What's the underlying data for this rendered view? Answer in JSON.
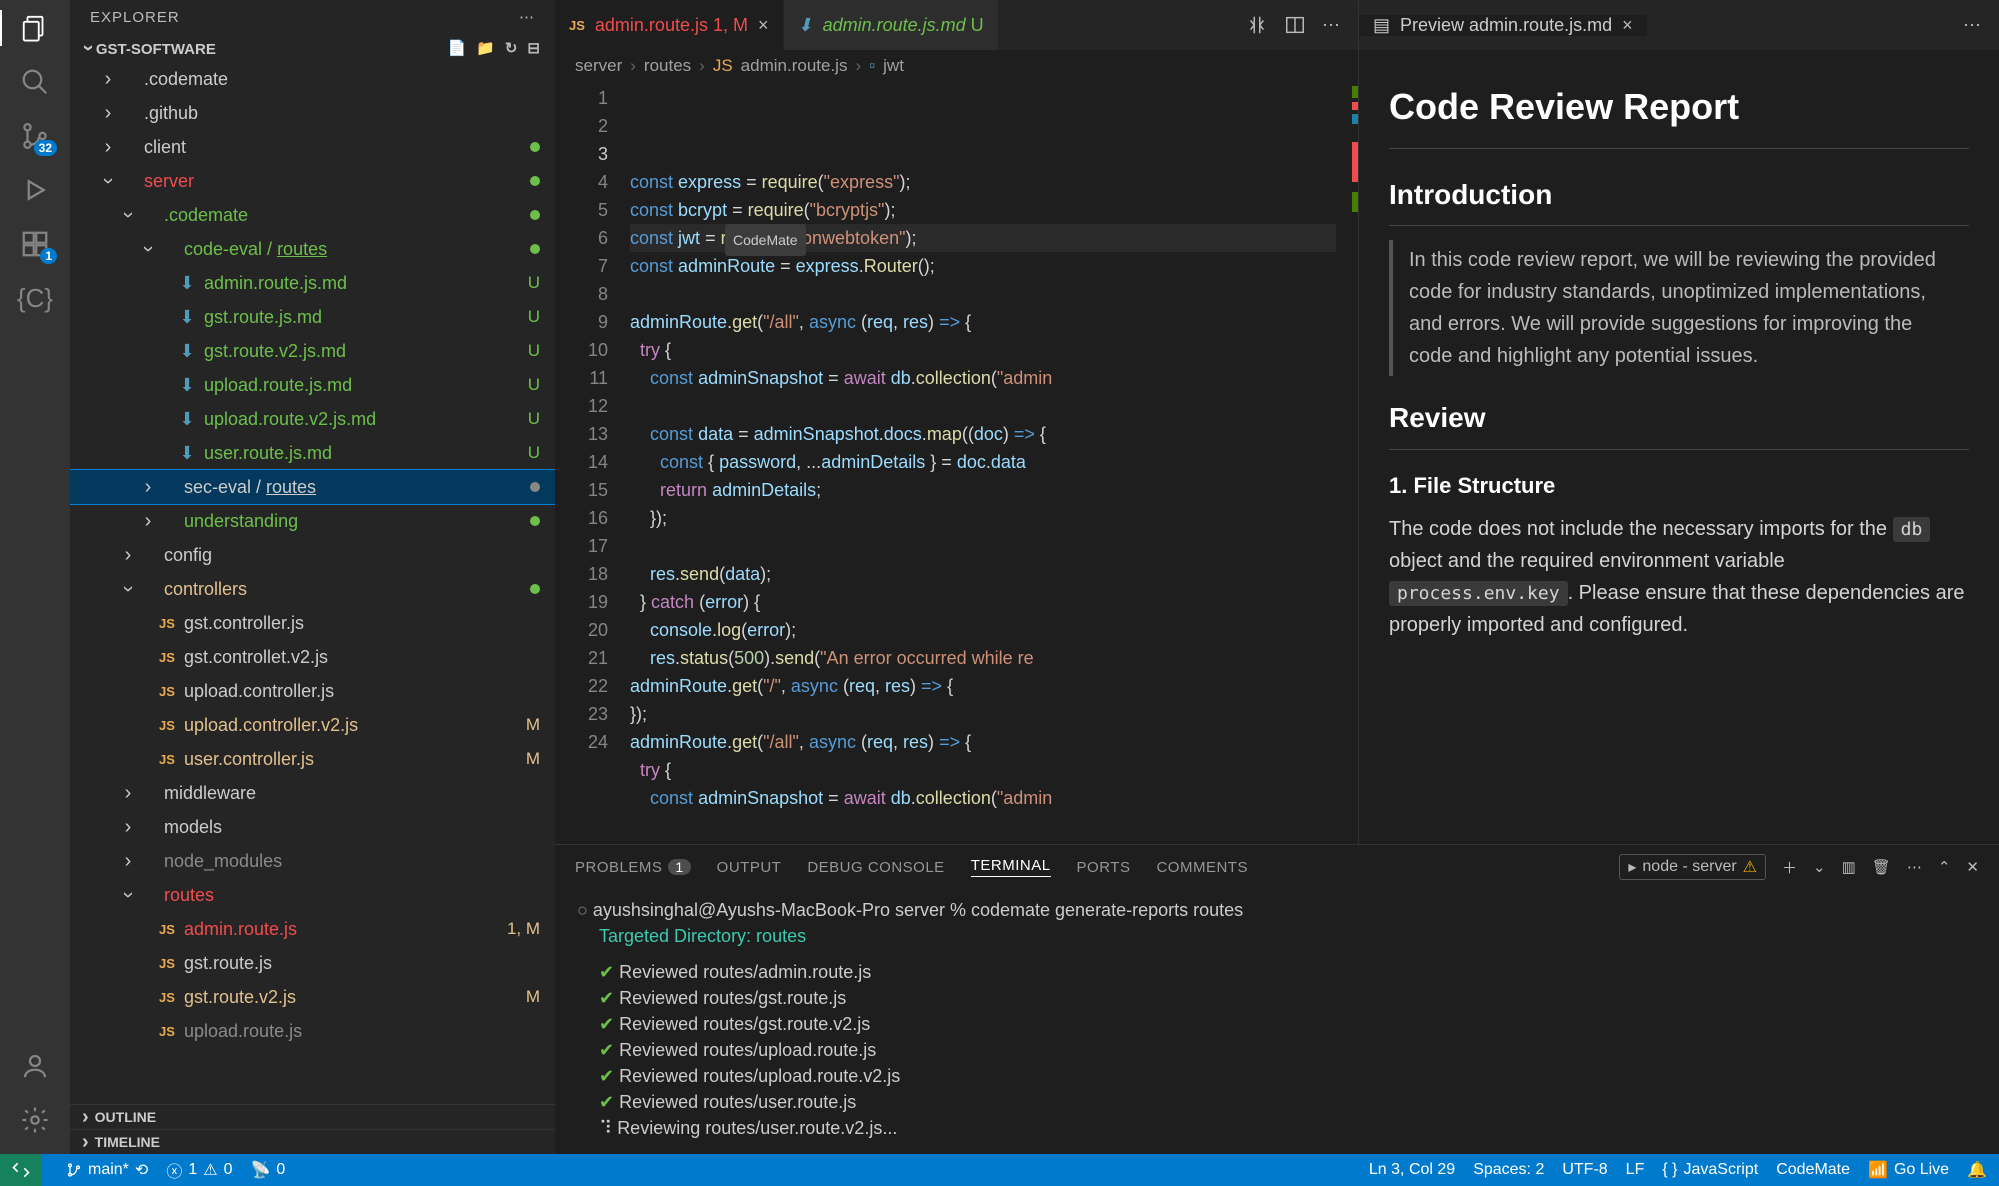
{
  "sidebar": {
    "title": "EXPLORER",
    "folder": "GST-SOFTWARE",
    "outline": "OUTLINE",
    "timeline": "TIMELINE"
  },
  "activity": {
    "scm_badge": "32",
    "ext_badge": "1"
  },
  "tree": [
    {
      "indent": 1,
      "chev": ">",
      "icon": "folder",
      "label": ".codemate",
      "color": ""
    },
    {
      "indent": 1,
      "chev": ">",
      "icon": "folder",
      "label": ".github",
      "color": ""
    },
    {
      "indent": 1,
      "chev": ">",
      "icon": "folder",
      "label": "client",
      "color": "",
      "status": "dot-green"
    },
    {
      "indent": 1,
      "chev": "v",
      "icon": "folder",
      "label": "server",
      "color": "fn-red",
      "status": "dot-green"
    },
    {
      "indent": 2,
      "chev": "v",
      "icon": "folder",
      "label": ".codemate",
      "color": "fn-green",
      "status": "dot-green"
    },
    {
      "indent": 3,
      "chev": "v",
      "icon": "folder",
      "label": "code-eval / routes",
      "color": "fn-green",
      "special": "routes-underline",
      "status": "dot-green"
    },
    {
      "indent": 4,
      "chev": "",
      "icon": "md",
      "label": "admin.route.js.md",
      "color": "fn-green",
      "status": "U"
    },
    {
      "indent": 4,
      "chev": "",
      "icon": "md",
      "label": "gst.route.js.md",
      "color": "fn-green",
      "status": "U"
    },
    {
      "indent": 4,
      "chev": "",
      "icon": "md",
      "label": "gst.route.v2.js.md",
      "color": "fn-green",
      "status": "U"
    },
    {
      "indent": 4,
      "chev": "",
      "icon": "md",
      "label": "upload.route.js.md",
      "color": "fn-green",
      "status": "U"
    },
    {
      "indent": 4,
      "chev": "",
      "icon": "md",
      "label": "upload.route.v2.js.md",
      "color": "fn-green",
      "status": "U"
    },
    {
      "indent": 4,
      "chev": "",
      "icon": "md",
      "label": "user.route.js.md",
      "color": "fn-green",
      "status": "U"
    },
    {
      "indent": 3,
      "chev": ">",
      "icon": "folder",
      "label": "sec-eval / routes",
      "color": "",
      "special": "routes-underline",
      "status": "dot-grey",
      "selected": true
    },
    {
      "indent": 3,
      "chev": ">",
      "icon": "folder",
      "label": "understanding",
      "color": "fn-green",
      "status": "dot-green"
    },
    {
      "indent": 2,
      "chev": ">",
      "icon": "folder",
      "label": "config",
      "color": ""
    },
    {
      "indent": 2,
      "chev": "v",
      "icon": "folder",
      "label": "controllers",
      "color": "fn-yellow",
      "status": "dot-green"
    },
    {
      "indent": 3,
      "chev": "",
      "icon": "js",
      "label": "gst.controller.js",
      "color": ""
    },
    {
      "indent": 3,
      "chev": "",
      "icon": "js",
      "label": "gst.controllet.v2.js",
      "color": ""
    },
    {
      "indent": 3,
      "chev": "",
      "icon": "js",
      "label": "upload.controller.js",
      "color": ""
    },
    {
      "indent": 3,
      "chev": "",
      "icon": "js",
      "label": "upload.controller.v2.js",
      "color": "fn-yellow",
      "status": "M"
    },
    {
      "indent": 3,
      "chev": "",
      "icon": "js",
      "label": "user.controller.js",
      "color": "fn-yellow",
      "status": "M"
    },
    {
      "indent": 2,
      "chev": ">",
      "icon": "folder",
      "label": "middleware",
      "color": ""
    },
    {
      "indent": 2,
      "chev": ">",
      "icon": "folder",
      "label": "models",
      "color": ""
    },
    {
      "indent": 2,
      "chev": ">",
      "icon": "folder",
      "label": "node_modules",
      "color": "fn-grey"
    },
    {
      "indent": 2,
      "chev": "v",
      "icon": "folder",
      "label": "routes",
      "color": "fn-red"
    },
    {
      "indent": 3,
      "chev": "",
      "icon": "js",
      "label": "admin.route.js",
      "color": "fn-red",
      "status": "1, M"
    },
    {
      "indent": 3,
      "chev": "",
      "icon": "js",
      "label": "gst.route.js",
      "color": ""
    },
    {
      "indent": 3,
      "chev": "",
      "icon": "js",
      "label": "gst.route.v2.js",
      "color": "fn-yellow",
      "status": "M"
    },
    {
      "indent": 3,
      "chev": "",
      "icon": "js",
      "label": "upload.route.js",
      "color": "fn-grey"
    }
  ],
  "tabs": [
    {
      "icon": "js",
      "label": "admin.route.js",
      "suffix": "1, M",
      "color": "fn-red",
      "close": "×",
      "active": true
    },
    {
      "icon": "md",
      "label": "admin.route.js.md",
      "suffix": "U",
      "color": "fn-green",
      "close": "",
      "active": false
    }
  ],
  "preview_tab": {
    "label": "Preview admin.route.js.md",
    "close": "×"
  },
  "breadcrumbs": [
    "server",
    "routes",
    "admin.route.js",
    "jwt"
  ],
  "code_lines": [
    "<span class='decl'>const</span> <span class='var'>express</span> <span class='pun'>=</span> <span class='fn'>require</span><span class='pun'>(</span><span class='str'>\"express\"</span><span class='pun'>);</span>",
    "<span class='decl'>const</span> <span class='var'>bcrypt</span> <span class='pun'>=</span> <span class='fn'>require</span><span class='pun'>(</span><span class='str'>\"bcryptjs\"</span><span class='pun'>);</span>",
    "<span class='decl'>const</span> <span class='var'>jwt</span> <span class='pun'>=</span> <span class='fn'>require</span><span class='pun'>(</span><span class='str'>\"jsonwebtoken\"</span><span class='pun'>);</span>",
    "<span class='decl'>const</span> <span class='var'>adminRoute</span> <span class='pun'>=</span> <span class='var'>express</span><span class='pun'>.</span><span class='fn'>Router</span><span class='pun'>();</span>",
    "",
    "<span class='var'>adminRoute</span><span class='pun'>.</span><span class='fn'>get</span><span class='pun'>(</span><span class='str'>\"/all\"</span><span class='pun'>,</span> <span class='decl'>async</span> <span class='pun'>(</span><span class='var'>req</span><span class='pun'>,</span> <span class='var'>res</span><span class='pun'>)</span> <span class='decl'>=&gt;</span> <span class='pun'>{</span>",
    "  <span class='kw'>try</span> <span class='pun'>{</span>",
    "    <span class='decl'>const</span> <span class='var'>adminSnapshot</span> <span class='pun'>=</span> <span class='kw'>await</span> <span class='var'>db</span><span class='pun'>.</span><span class='fn'>collection</span><span class='pun'>(</span><span class='str'>\"admin</span>",
    "",
    "    <span class='decl'>const</span> <span class='var'>data</span> <span class='pun'>=</span> <span class='var'>adminSnapshot</span><span class='pun'>.</span><span class='var'>docs</span><span class='pun'>.</span><span class='fn'>map</span><span class='pun'>((</span><span class='var'>doc</span><span class='pun'>)</span> <span class='decl'>=&gt;</span> <span class='pun'>{</span>",
    "      <span class='decl'>const</span> <span class='pun'>{</span> <span class='var'>password</span><span class='pun'>,</span> <span class='pun'>...</span><span class='var'>adminDetails</span> <span class='pun'>}</span> <span class='pun'>=</span> <span class='var'>doc</span><span class='pun'>.</span><span class='var'>data</span>",
    "      <span class='kw'>return</span> <span class='var'>adminDetails</span><span class='pun'>;</span>",
    "    <span class='pun'>});</span>",
    "",
    "    <span class='var'>res</span><span class='pun'>.</span><span class='fn'>send</span><span class='pun'>(</span><span class='var'>data</span><span class='pun'>);</span>",
    "  <span class='pun'>}</span> <span class='kw'>catch</span> <span class='pun'>(</span><span class='var'>error</span><span class='pun'>)</span> <span class='pun'>{</span>",
    "    <span class='var'>console</span><span class='pun'>.</span><span class='fn'>log</span><span class='pun'>(</span><span class='var'>error</span><span class='pun'>);</span>",
    "    <span class='var'>res</span><span class='pun'>.</span><span class='fn'>status</span><span class='pun'>(</span><span class='num'>500</span><span class='pun'>).</span><span class='fn'>send</span><span class='pun'>(</span><span class='str'>\"An error occurred while re</span>",
    "<span class='var'>adminRoute</span><span class='pun'>.</span><span class='fn'>get</span><span class='pun'>(</span><span class='str'>\"/\"</span><span class='pun'>,</span> <span class='decl'>async</span> <span class='pun'>(</span><span class='var'>req</span><span class='pun'>,</span> <span class='var'>res</span><span class='pun'>)</span> <span class='decl'>=&gt;</span> <span class='pun'>{</span>",
    "<span class='pun'>});</span>",
    "<span class='var'>adminRoute</span><span class='pun'>.</span><span class='fn'>get</span><span class='pun'>(</span><span class='str'>\"/all\"</span><span class='pun'>,</span> <span class='decl'>async</span> <span class='pun'>(</span><span class='var'>req</span><span class='pun'>,</span> <span class='var'>res</span><span class='pun'>)</span> <span class='decl'>=&gt;</span> <span class='pun'>{</span>",
    "  <span class='kw'>try</span> <span class='pun'>{</span>",
    "    <span class='decl'>const</span> <span class='var'>adminSnapshot</span> <span class='pun'>=</span> <span class='kw'>await</span> <span class='var'>db</span><span class='pun'>.</span><span class='fn'>collection</span><span class='pun'>(</span><span class='str'>\"admin</span>",
    ""
  ],
  "codemate_label": "CodeMate",
  "preview": {
    "h1": "Code Review Report",
    "h2a": "Introduction",
    "quote": "In this code review report, we will be reviewing the provided code for industry standards, unoptimized implementations, and errors. We will provide suggestions for improving the code and highlight any potential issues.",
    "h2b": "Review",
    "h3": "1. File Structure",
    "p1a": "The code does not include the necessary imports for the ",
    "code1": "db",
    "p1b": " object and the required environment variable ",
    "code2": "process.env.key",
    "p1c": ". Please ensure that these dependencies are properly imported and configured."
  },
  "panel": {
    "tabs": [
      "PROBLEMS",
      "OUTPUT",
      "DEBUG CONSOLE",
      "TERMINAL",
      "PORTS",
      "COMMENTS"
    ],
    "problems_badge": "1",
    "term_select": "node - server"
  },
  "terminal": {
    "prompt": "ayushsinghal@Ayushs-MacBook-Pro server % codemate generate-reports routes",
    "line1": "Targeted Directory: routes",
    "reviewed": [
      "Reviewed routes/admin.route.js",
      "Reviewed routes/gst.route.js",
      "Reviewed routes/gst.route.v2.js",
      "Reviewed routes/upload.route.js",
      "Reviewed routes/upload.route.v2.js",
      "Reviewed routes/user.route.js"
    ],
    "reviewing": "Reviewing routes/user.route.v2.js..."
  },
  "statusbar": {
    "branch": "main*",
    "errors": "1",
    "warnings": "0",
    "port": "0",
    "pos": "Ln 3, Col 29",
    "spaces": "Spaces: 2",
    "encoding": "UTF-8",
    "eol": "LF",
    "lang": "JavaScript",
    "codemate": "CodeMate",
    "golive": "Go Live"
  }
}
